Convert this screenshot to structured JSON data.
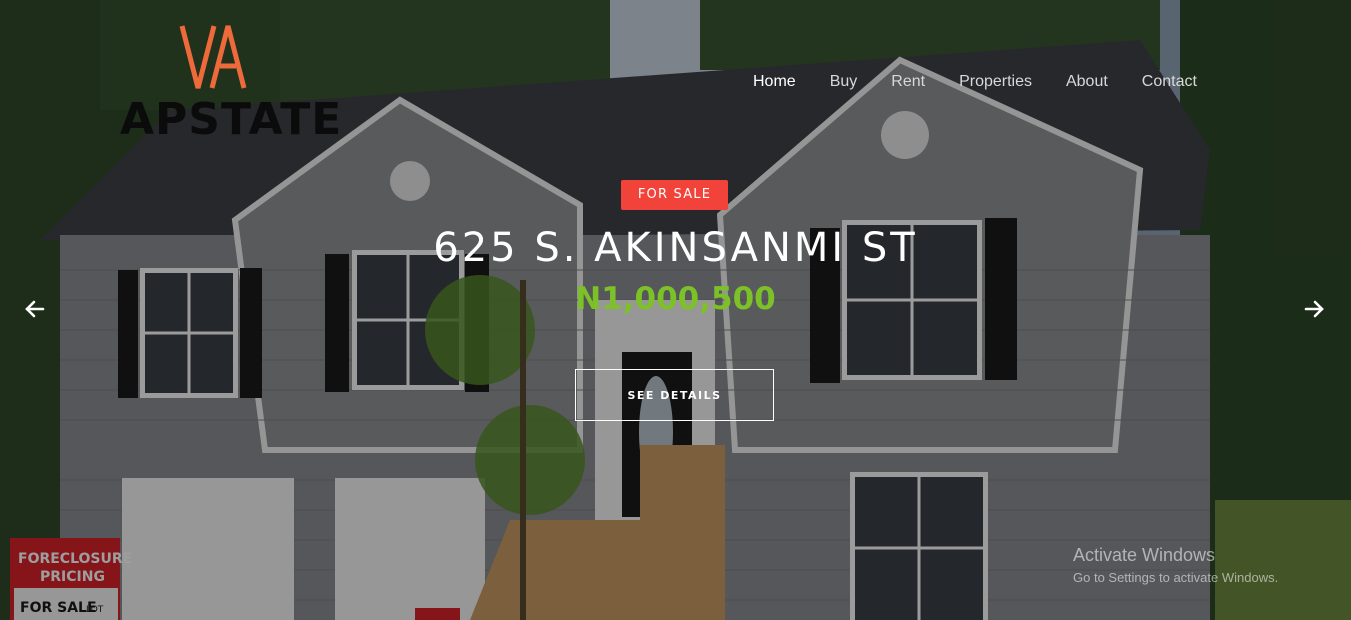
{
  "brand": {
    "name": "APSTATE",
    "accent": "#ee6a3a"
  },
  "nav": {
    "items": [
      {
        "label": "Home"
      },
      {
        "label": "Buy"
      },
      {
        "label": "Rent"
      },
      {
        "label": "Properties"
      },
      {
        "label": "About"
      },
      {
        "label": "Contact"
      }
    ],
    "active": "Home"
  },
  "slide": {
    "badge": "FOR SALE",
    "title": "625 S. AKINSANMI ST",
    "price": "N1,000,500",
    "cta": "SEE DETAILS",
    "badge_color": "#f2433a",
    "price_color": "#7cc128"
  },
  "photo_signs": {
    "foreclosure_line1": "FORECLOSURE",
    "foreclosure_line2": "PRICING",
    "for_sale": "FOR SALE",
    "lot": "LOT"
  },
  "icons": {
    "prev": "arrow-left-icon",
    "next": "arrow-right-icon"
  },
  "watermark": {
    "line1": "Activate Windows",
    "line2": "Go to Settings to activate Windows."
  }
}
